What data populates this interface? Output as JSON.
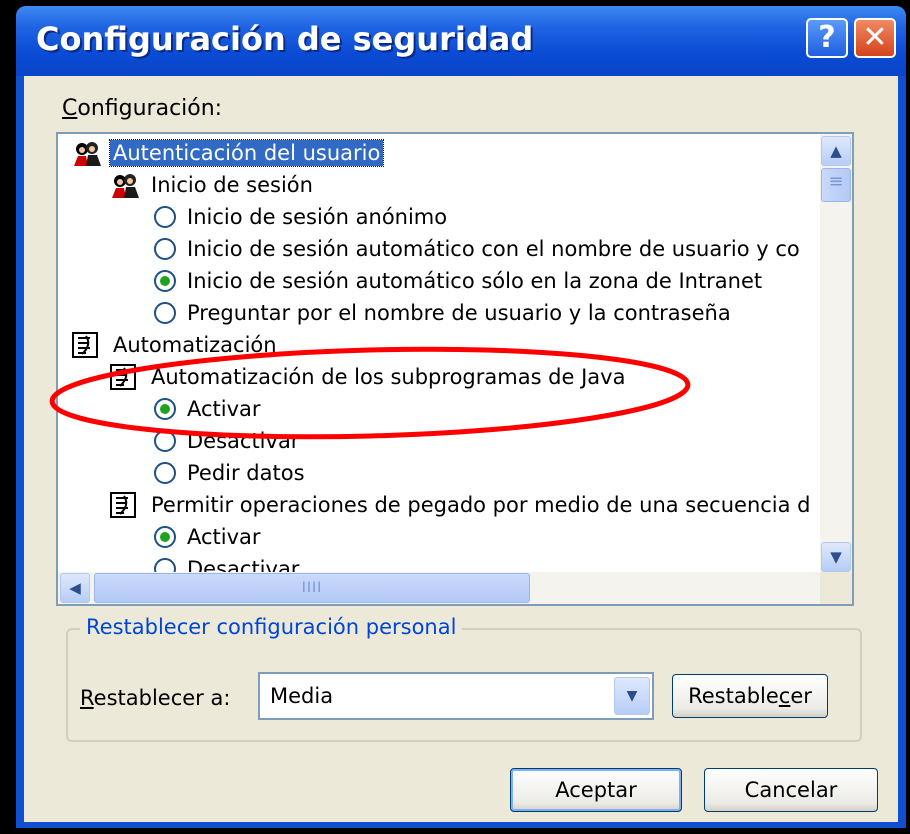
{
  "window": {
    "title": "Configuración de seguridad",
    "help_label": "?",
    "close_label": "✕"
  },
  "config_label": {
    "accel": "C",
    "rest": "onfiguración:"
  },
  "tree": [
    {
      "kind": "people",
      "label": "Autenticación del usuario",
      "selected": true
    },
    {
      "kind": "people",
      "label": "Inicio de sesión"
    },
    {
      "kind": "radio",
      "label": "Inicio de sesión anónimo",
      "checked": false
    },
    {
      "kind": "radio",
      "label": "Inicio de sesión automático con el nombre de usuario y co",
      "checked": false
    },
    {
      "kind": "radio",
      "label": "Inicio de sesión automático sólo en la zona de Intranet",
      "checked": true
    },
    {
      "kind": "radio",
      "label": "Preguntar por el nombre de usuario y la contraseña",
      "checked": false
    },
    {
      "kind": "doc",
      "label": "Automatización"
    },
    {
      "kind": "doc",
      "label": "Automatización de los subprogramas de Java"
    },
    {
      "kind": "radio",
      "label": "Activar",
      "checked": true
    },
    {
      "kind": "radio",
      "label": "Desactivar",
      "checked": false
    },
    {
      "kind": "radio",
      "label": "Pedir datos",
      "checked": false
    },
    {
      "kind": "doc",
      "label": "Permitir operaciones de pegado por medio de una secuencia d"
    },
    {
      "kind": "radio",
      "label": "Activar",
      "checked": true
    },
    {
      "kind": "radio",
      "label": "Desactivar",
      "checked": false
    }
  ],
  "scrollbar": {
    "up_icon": "▲",
    "down_icon": "▼",
    "left_icon": "◀",
    "right_icon": "▶",
    "thumb_grip": "IIII"
  },
  "reset_group": {
    "legend": "Restablecer configuración personal",
    "label_accel": "R",
    "label_rest": "establecer a:",
    "select_value": "Media",
    "select_arrow": "▼",
    "button_pre": "Restable",
    "button_accel": "c",
    "button_post": "er"
  },
  "footer": {
    "ok_label": "Aceptar",
    "cancel_label": "Cancelar"
  },
  "annotation": {
    "color": "#ff0000"
  }
}
